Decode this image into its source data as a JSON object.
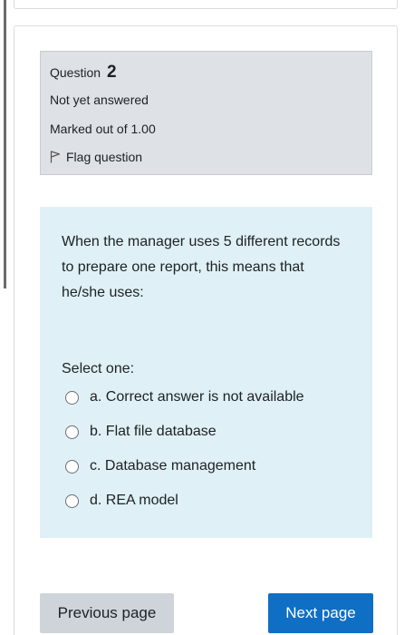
{
  "question": {
    "label": "Question",
    "number": "2",
    "status": "Not yet answered",
    "marks": "Marked out of 1.00",
    "flag_label": "Flag question",
    "text": "When the manager uses 5 different records to prepare one report, this means that he/she uses:",
    "select_prompt": "Select one:",
    "options": [
      {
        "label": "a. Correct answer is not available"
      },
      {
        "label": "b. Flat file database"
      },
      {
        "label": "c. Database management"
      },
      {
        "label": "d. REA model"
      }
    ]
  },
  "navigation": {
    "previous_label": "Previous page",
    "next_label": "Next page"
  },
  "colors": {
    "info_bg": "#dee2e6",
    "content_bg": "#dff0f6",
    "primary_button": "#0f6fc5",
    "secondary_button": "#ced4da"
  },
  "icons": {
    "flag": "flag-icon",
    "radio": "radio-unchecked-icon"
  }
}
